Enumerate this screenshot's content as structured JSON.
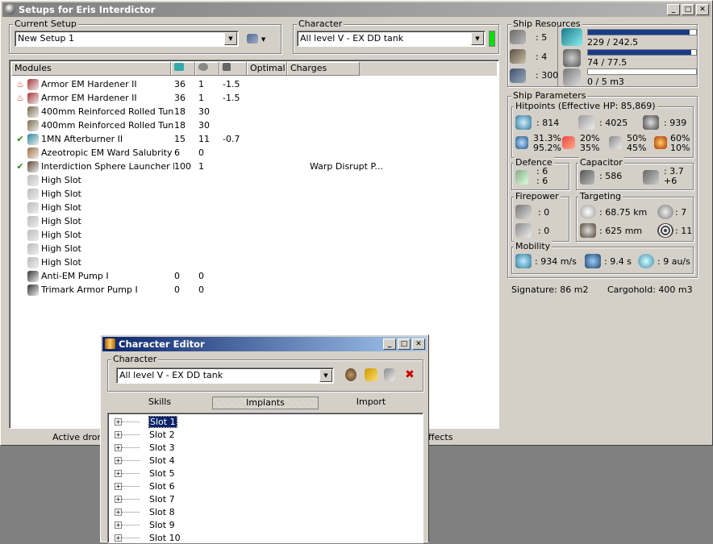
{
  "main_window": {
    "title": "Setups for Eris Interdictor",
    "controls": {
      "minimize": "_",
      "maximize": "□",
      "close": "✕"
    }
  },
  "current_setup": {
    "label": "Current Setup",
    "value": "New Setup 1"
  },
  "character": {
    "label": "Character",
    "value": "All level V - EX DD tank"
  },
  "modules_table": {
    "columns": [
      "Modules",
      "",
      "",
      "",
      "Optimal",
      "Charges"
    ],
    "rows": [
      {
        "status": "heat",
        "name": "Armor EM Hardener II",
        "cpu": "36",
        "pg": "1",
        "cap": "-1.5",
        "optimal": "",
        "charges": ""
      },
      {
        "status": "heat",
        "name": "Armor EM Hardener II",
        "cpu": "36",
        "pg": "1",
        "cap": "-1.5",
        "optimal": "",
        "charges": ""
      },
      {
        "status": "",
        "name": "400mm Reinforced Rolled Tun...",
        "cpu": "18",
        "pg": "30",
        "cap": "",
        "optimal": "",
        "charges": ""
      },
      {
        "status": "",
        "name": "400mm Reinforced Rolled Tun...",
        "cpu": "18",
        "pg": "30",
        "cap": "",
        "optimal": "",
        "charges": ""
      },
      {
        "status": "✔",
        "name": "1MN Afterburner II",
        "cpu": "15",
        "pg": "11",
        "cap": "-0.7",
        "optimal": "",
        "charges": ""
      },
      {
        "status": "",
        "name": "Azeotropic EM Ward Salubrity",
        "cpu": "6",
        "pg": "0",
        "cap": "",
        "optimal": "",
        "charges": ""
      },
      {
        "status": "✔",
        "name": "Interdiction Sphere Launcher I",
        "cpu": "100",
        "pg": "1",
        "cap": "",
        "optimal": "",
        "charges": "Warp Disrupt P..."
      },
      {
        "status": "",
        "name": "High Slot",
        "cpu": "",
        "pg": "",
        "cap": "",
        "optimal": "",
        "charges": ""
      },
      {
        "status": "",
        "name": "High Slot",
        "cpu": "",
        "pg": "",
        "cap": "",
        "optimal": "",
        "charges": ""
      },
      {
        "status": "",
        "name": "High Slot",
        "cpu": "",
        "pg": "",
        "cap": "",
        "optimal": "",
        "charges": ""
      },
      {
        "status": "",
        "name": "High Slot",
        "cpu": "",
        "pg": "",
        "cap": "",
        "optimal": "",
        "charges": ""
      },
      {
        "status": "",
        "name": "High Slot",
        "cpu": "",
        "pg": "",
        "cap": "",
        "optimal": "",
        "charges": ""
      },
      {
        "status": "",
        "name": "High Slot",
        "cpu": "",
        "pg": "",
        "cap": "",
        "optimal": "",
        "charges": ""
      },
      {
        "status": "",
        "name": "High Slot",
        "cpu": "",
        "pg": "",
        "cap": "",
        "optimal": "",
        "charges": ""
      },
      {
        "status": "",
        "name": "Anti-EM Pump I",
        "cpu": "0",
        "pg": "0",
        "cap": "",
        "optimal": "",
        "charges": ""
      },
      {
        "status": "",
        "name": "Trimark Armor Pump I",
        "cpu": "0",
        "pg": "0",
        "cap": "",
        "optimal": "",
        "charges": ""
      }
    ]
  },
  "bottom_tabs": {
    "left": "Active drone",
    "right": "ffects"
  },
  "ship_resources": {
    "label": "Ship Resources",
    "turrets": ": 5",
    "launchers": ": 4",
    "calibration": ": 300",
    "cpu": "229 / 242.5",
    "cpu_fraction": 0.944,
    "powergrid": "74 / 77.5",
    "pg_fraction": 0.955,
    "drone_bay": "0 / 5 m3",
    "drone_fraction": 0
  },
  "ship_parameters": {
    "label": "Ship Parameters",
    "hitpoints": {
      "label": "Hitpoints (Effective HP: 85,869)",
      "shield": ": 814",
      "armor": ": 4025",
      "structure": ": 939",
      "em": [
        "31.3%",
        "95.2%"
      ],
      "thermal": [
        "20%",
        "35%"
      ],
      "kinetic": [
        "50%",
        "45%"
      ],
      "explosive": [
        "60%",
        "10%"
      ]
    },
    "defence": {
      "label": "Defence",
      "a": ": 6",
      "b": ": 6"
    },
    "capacitor": {
      "label": "Capacitor",
      "amount": ": 586",
      "regen": ": 3.7",
      "delta": "+6"
    },
    "firepower": {
      "label": "Firepower",
      "a": ": 0",
      "b": ": 0"
    },
    "targeting": {
      "label": "Targeting",
      "range": ": 68.75 km",
      "targets": ": 7",
      "scan": ": 625 mm",
      "sensor": ": 11"
    },
    "mobility": {
      "label": "Mobility",
      "speed": ": 934 m/s",
      "align": ": 9.4 s",
      "warp": ": 9 au/s"
    },
    "signature": "Signature: 86 m2",
    "cargohold": "Cargohold: 400 m3"
  },
  "character_editor": {
    "title": "Character Editor",
    "character_label": "Character",
    "character_value": "All level V - EX DD tank",
    "tabs": [
      "Skills",
      "Implants",
      "Import"
    ],
    "active_tab": "Implants",
    "slots": [
      "Slot 1",
      "Slot 2",
      "Slot 3",
      "Slot 4",
      "Slot 5",
      "Slot 6",
      "Slot 7",
      "Slot 8",
      "Slot 9",
      "Slot 10"
    ]
  },
  "colors": {
    "cpu_bar": "#1a3a8a",
    "status_green": "#2a8a1a",
    "indicator": "#00e000",
    "accent": "#0a246a"
  }
}
